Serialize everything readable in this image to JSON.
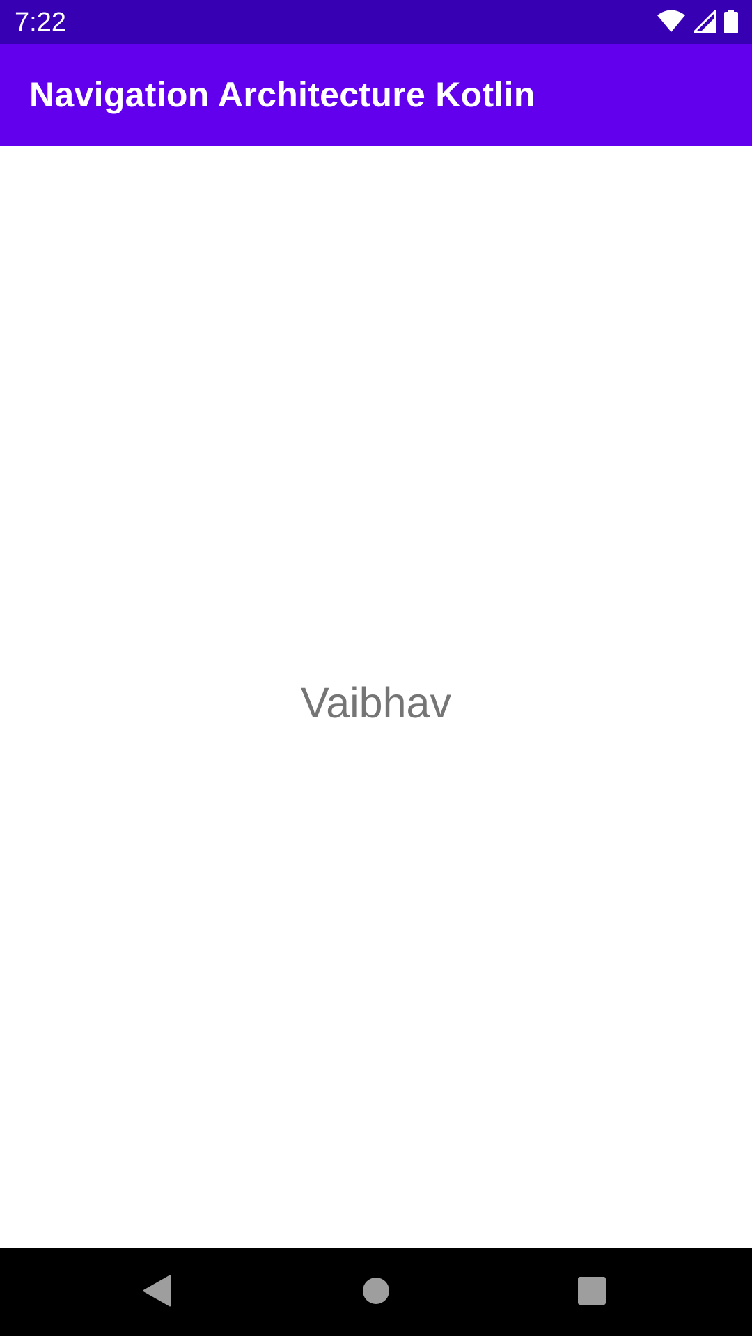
{
  "status_bar": {
    "time": "7:22",
    "icons": [
      "wifi-icon",
      "cell-signal-icon",
      "battery-icon"
    ],
    "background": "#3700b3"
  },
  "app_bar": {
    "title": "Navigation Architecture Kotlin",
    "background": "#6200ee"
  },
  "content": {
    "text": "Vaibhav",
    "text_color": "#757575"
  },
  "nav_bar": {
    "buttons": [
      "back-icon",
      "home-icon",
      "recents-icon"
    ],
    "background": "#000000"
  }
}
